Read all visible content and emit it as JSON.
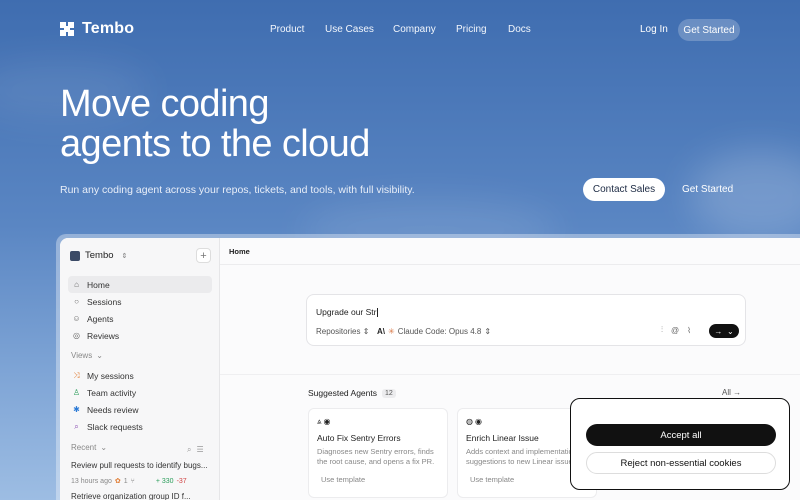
{
  "brand": {
    "name": "Tembo"
  },
  "nav": {
    "links": [
      "Product",
      "Use Cases",
      "Company",
      "Pricing",
      "Docs"
    ],
    "login": "Log In",
    "get_started": "Get Started"
  },
  "hero": {
    "title_line1": "Move coding",
    "title_line2": "agents to the cloud",
    "subtitle": "Run any coding agent across your repos, tickets, and tools, with full visibility.",
    "contact_sales": "Contact Sales",
    "get_started": "Get Started"
  },
  "app": {
    "workspace": "Tembo",
    "sidebar": {
      "items": [
        {
          "label": "Home",
          "icon": "home-icon"
        },
        {
          "label": "Sessions",
          "icon": "circle-icon"
        },
        {
          "label": "Agents",
          "icon": "agent-icon"
        },
        {
          "label": "Reviews",
          "icon": "review-icon"
        }
      ],
      "views_label": "Views",
      "views": [
        {
          "label": "My sessions",
          "icon": "shuffle-icon"
        },
        {
          "label": "Team activity",
          "icon": "person-icon"
        },
        {
          "label": "Needs review",
          "icon": "asterisk-icon"
        },
        {
          "label": "Slack requests",
          "icon": "search-icon"
        }
      ],
      "recent_label": "Recent",
      "recent": [
        "Review pull requests to identify bugs...",
        "Retrieve organization group ID f..."
      ],
      "recent_meta": {
        "time": "13 hours ago",
        "count": "1",
        "added": "+ 330",
        "removed": "-37"
      }
    },
    "breadcrumb": "Home",
    "composer": {
      "text": "Upgrade our Str",
      "repositories": "Repositories",
      "model": "Claude Code: Opus 4.8"
    },
    "suggested": {
      "title": "Suggested Agents",
      "count": "12",
      "all": "All",
      "cards": [
        {
          "title": "Auto Fix Sentry Errors",
          "desc": "Diagnoses new Sentry errors, finds the root cause, and opens a fix PR.",
          "use": "Use template"
        },
        {
          "title": "Enrich Linear Issue",
          "desc": "Adds context and implementation suggestions to new Linear issues.",
          "use": "Use template"
        }
      ]
    }
  },
  "cookie": {
    "accept": "Accept all",
    "reject": "Reject non-essential cookies"
  }
}
